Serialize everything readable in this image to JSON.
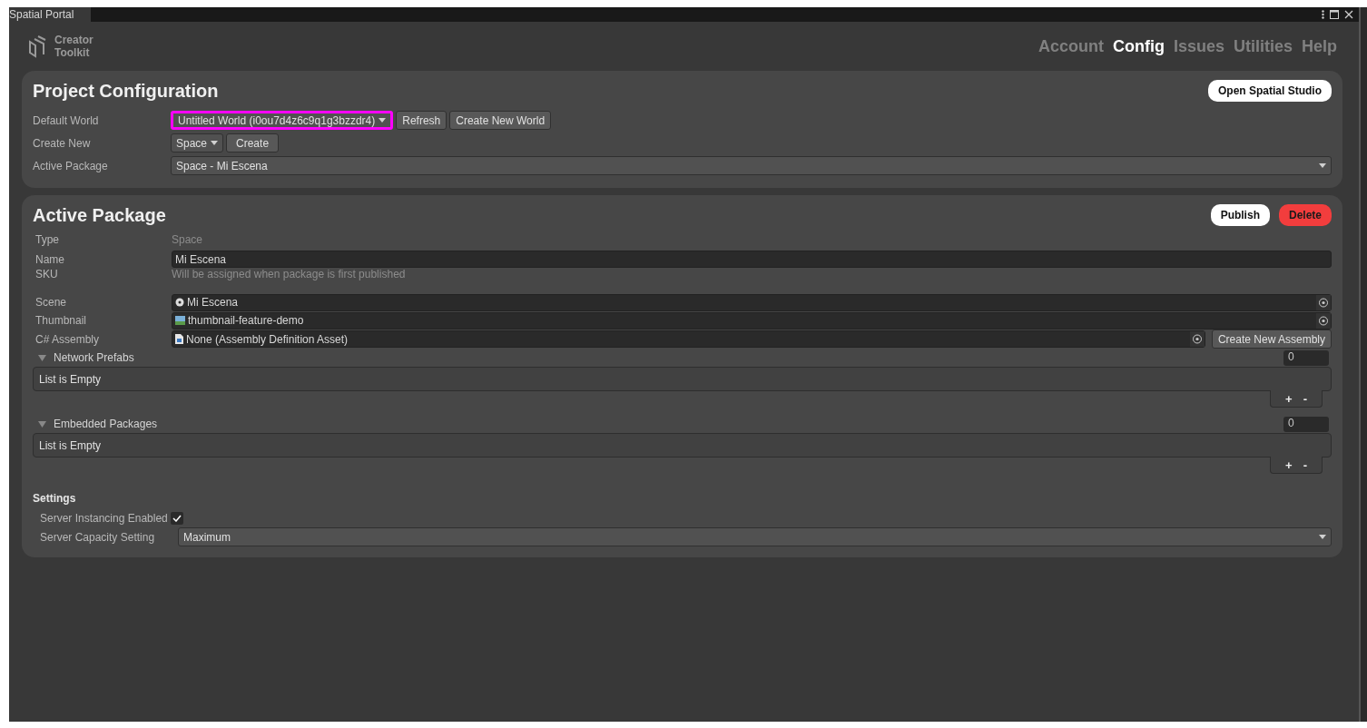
{
  "window": {
    "title": "Spatial Portal"
  },
  "header": {
    "logo_lines": [
      "Creator",
      "Toolkit"
    ],
    "nav": [
      {
        "label": "Account",
        "selected": false
      },
      {
        "label": "Config",
        "selected": true
      },
      {
        "label": "Issues",
        "selected": false
      },
      {
        "label": "Utilities",
        "selected": false
      },
      {
        "label": "Help",
        "selected": false
      }
    ]
  },
  "project_configuration": {
    "title": "Project Configuration",
    "action": "Open Spatial Studio",
    "default_world": {
      "label": "Default World",
      "value": "Untitled World (i0ou7d4z6c9q1g3bzzdr4)",
      "highlighted": true,
      "buttons": [
        "Refresh",
        "Create New World"
      ]
    },
    "create_new": {
      "label": "Create New",
      "value": "Space",
      "button": "Create"
    },
    "active_package": {
      "label": "Active Package",
      "value": "Space - Mi Escena"
    }
  },
  "active_package": {
    "title": "Active Package",
    "actions": [
      {
        "label": "Publish",
        "kind": "primary"
      },
      {
        "label": "Delete",
        "kind": "danger"
      }
    ],
    "fields": [
      {
        "label": "Type",
        "value": "Space",
        "kind": "readonly"
      },
      {
        "label": "Name",
        "value": "Mi Escena",
        "kind": "input"
      },
      {
        "label": "SKU",
        "value": "Will be assigned when package is first published",
        "kind": "readonly"
      },
      {
        "label": "Scene",
        "value": "Mi Escena",
        "kind": "object"
      },
      {
        "label": "Thumbnail",
        "value": "thumbnail-feature-demo",
        "kind": "object"
      },
      {
        "label": "C# Assembly",
        "value": "None (Assembly Definition Asset)",
        "kind": "object",
        "button": "Create New Assembly"
      }
    ],
    "lists": [
      {
        "label": "Network Prefabs",
        "expanded": true,
        "count": "0",
        "empty_text": "List is Empty",
        "add": "+",
        "remove": "-"
      },
      {
        "label": "Embedded Packages",
        "expanded": true,
        "count": "0",
        "empty_text": "List is Empty",
        "add": "+",
        "remove": "-"
      }
    ],
    "settings": {
      "title": "Settings",
      "instancing": {
        "label": "Server Instancing Enabled",
        "checked": true
      },
      "capacity": {
        "label": "Server Capacity Setting",
        "value": "Maximum"
      }
    }
  }
}
